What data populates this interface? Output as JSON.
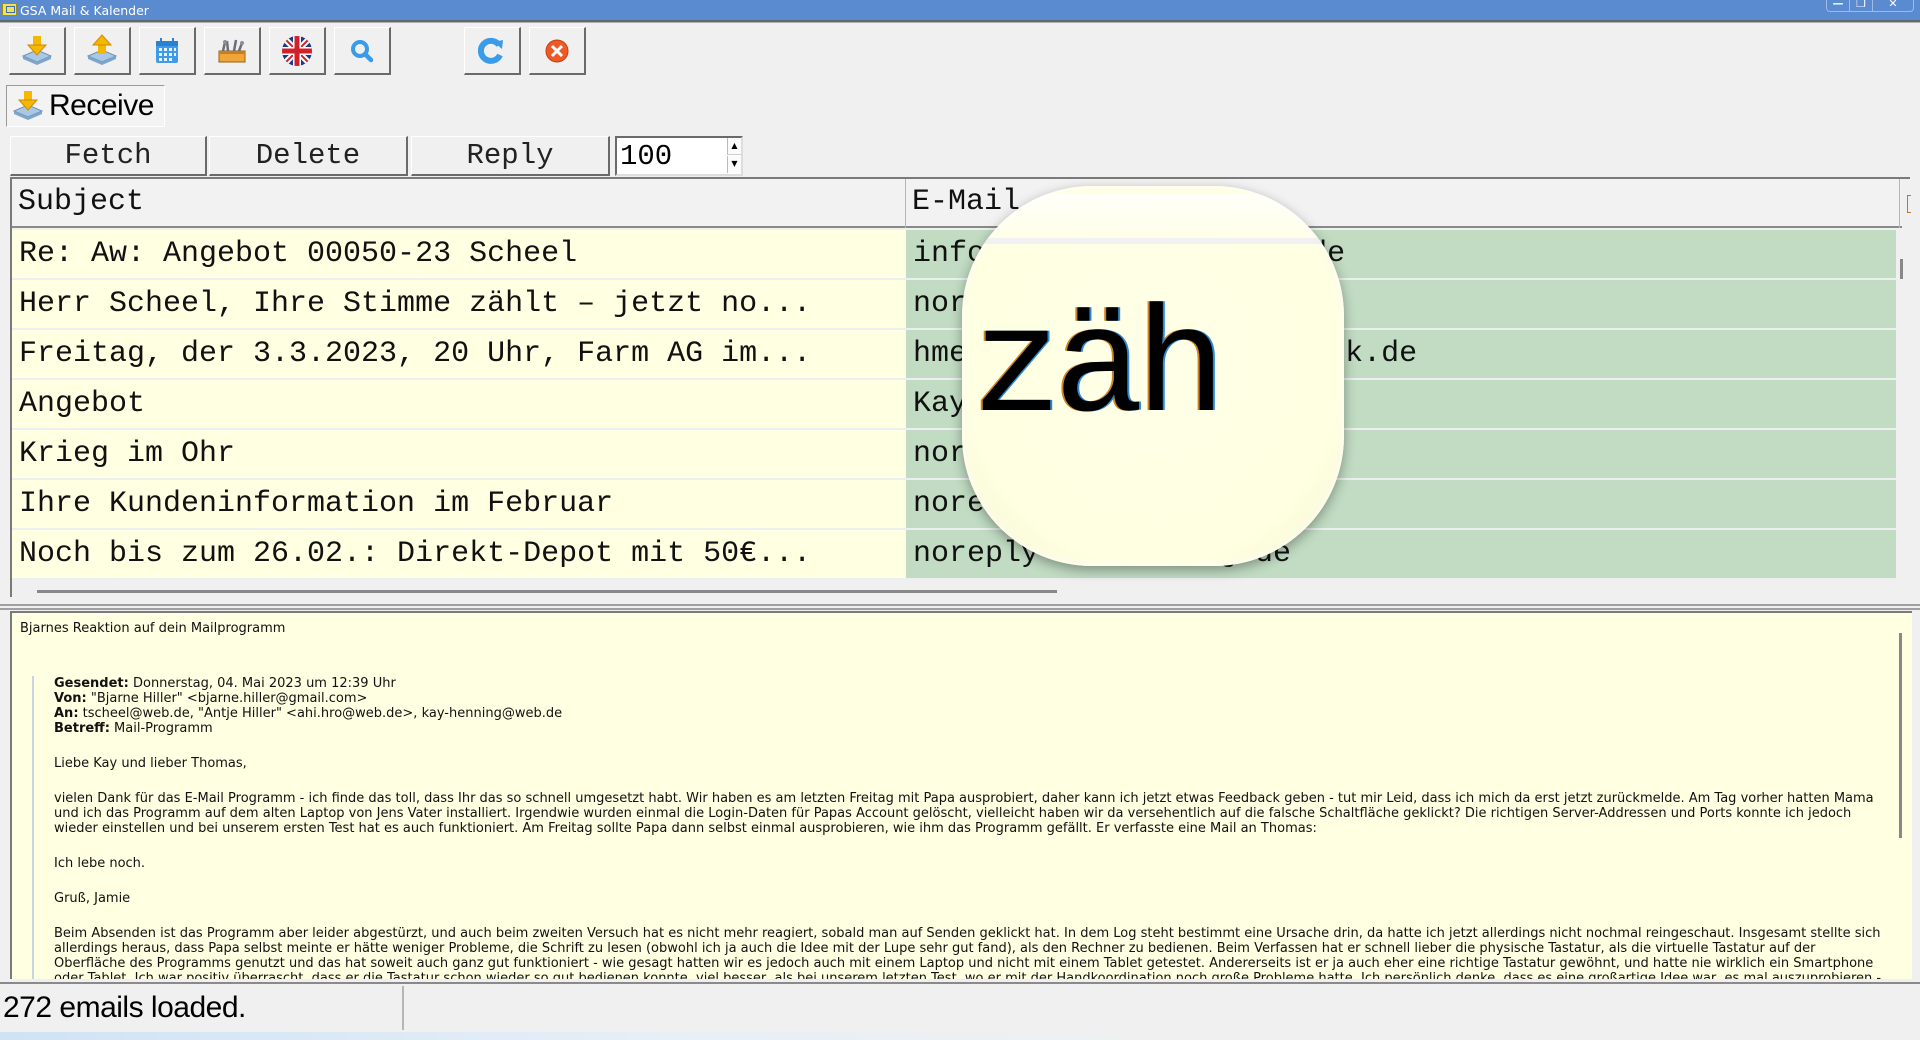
{
  "window": {
    "title": "GSA Mail & Kalender",
    "controls": {
      "minimize": "—",
      "restore": "❐",
      "close": "✕"
    }
  },
  "toolbar": {
    "buttons": [
      {
        "icon": "download-icon",
        "tooltip": "Receive"
      },
      {
        "icon": "upload-icon",
        "tooltip": "Send"
      },
      {
        "icon": "calendar-icon",
        "tooltip": "Calendar"
      },
      {
        "icon": "toolbox-icon",
        "tooltip": "Tools"
      },
      {
        "icon": "uk-flag-icon",
        "tooltip": "Language"
      },
      {
        "icon": "magnifier-icon",
        "tooltip": "Magnifier"
      },
      {
        "icon": "refresh-icon",
        "tooltip": "Refresh"
      },
      {
        "icon": "close-circle-icon",
        "tooltip": "Exit"
      }
    ]
  },
  "mode_label": "Receive",
  "actions": {
    "fetch": "Fetch",
    "delete": "Delete",
    "reply": "Reply",
    "count_value": "100"
  },
  "table": {
    "columns": [
      "Subject",
      "E-Mail"
    ],
    "rows": [
      {
        "subject": "Re: Aw: Angebot 00050-23 Scheel",
        "email": "info                n.de"
      },
      {
        "subject": "Herr Scheel, Ihre Stimme zählt – jetzt no...",
        "email": "nor"
      },
      {
        "subject": "Freitag, der 3.3.2023, 20 Uhr, Farm AG im...",
        "email": "hme                 stock.de"
      },
      {
        "subject": "Angebot",
        "email": "Kay                ck.de"
      },
      {
        "subject": "Krieg im Ohr",
        "email": "nor                f.de"
      },
      {
        "subject": "Ihre Kundeninformation im Februar",
        "email": "nore"
      },
      {
        "subject": "Noch bis zum 26.02.: Direkt-Depot mit 50€...",
        "email": "noreply          g.de"
      }
    ]
  },
  "magnifier": {
    "text": "zäh"
  },
  "preview": {
    "subject": "Bjarnes Reaktion auf dein Mailprogramm",
    "headers": [
      {
        "label": "Gesendet:",
        "value": " Donnerstag, 04. Mai 2023 um 12:39 Uhr"
      },
      {
        "label": "Von:",
        "value": " \"Bjarne Hiller\" <bjarne.hiller@gmail.com>"
      },
      {
        "label": "An:",
        "value": " tscheel@web.de, \"Antje Hiller\" <ahi.hro@web.de>, kay-henning@web.de"
      },
      {
        "label": "Betreff:",
        "value": " Mail-Programm"
      }
    ],
    "greeting": "Liebe Kay und lieber Thomas,",
    "paragraph1": "vielen Dank für das E-Mail Programm - ich finde das toll, dass Ihr das so schnell umgesetzt habt. Wir haben es am letzten Freitag mit Papa ausprobiert, daher kann ich jetzt etwas Feedback geben - tut mir Leid, dass ich mich da erst jetzt zurückmelde. Am Tag vorher hatten Mama und ich das Programm auf dem alten Laptop von Jens Vater installiert. Irgendwie wurden einmal die Login-Daten für Papas Account gelöscht, vielleicht haben wir da versehentlich auf die falsche Schaltfläche geklickt? Die richtigen Server-Addressen und Ports konnte ich jedoch wieder einstellen und bei unserem ersten Test hat es auch funktioniert. Am Freitag sollte Papa dann selbst einmal ausprobieren, wie ihm das Programm gefällt. Er verfasste eine Mail an Thomas:",
    "quote_line": "Ich lebe noch.",
    "signoff": "Gruß, Jamie",
    "paragraph2": "Beim Absenden ist das Programm aber leider abgestürzt, und auch beim zweiten Versuch hat es nicht mehr reagiert, sobald man auf Senden geklickt hat. In dem Log steht bestimmt eine Ursache drin, da hatte ich jetzt allerdings nicht nochmal reingeschaut. Insgesamt stellte sich allerdings heraus, dass Papa selbst meinte er hätte weniger Probleme, die Schrift zu lesen (obwohl ich ja auch die Idee mit der Lupe sehr gut fand), als den Rechner zu bedienen. Beim Verfassen hat er schnell lieber die physische Tastatur, als die virtuelle Tastatur auf der Oberfläche des Programms genutzt und das hat soweit auch ganz gut funktioniert - wie gesagt hatten wir es jedoch auch mit einem Laptop und nicht mit einem Tablet getestet. Andererseits ist er ja auch eher eine richtige Tastatur gewöhnt, und hatte nie wirklich ein Smartphone oder Tablet. Ich war positiv überrascht, dass er die Tastatur schon wieder so gut bedienen konnte, viel besser, als bei unserem letzten Test, wo er mit der Handkoordination noch große Probleme hatte. Ich persönlich denke, dass es eine großartige Idee war, es mal auszuprobieren - aber sich jetzt doch die Frage stellt, ob man das E-Mail Programm noch weiterentwickeln möchte, was ja auch Zeit und Arbeit kostet. Am sinnvollsten wäre glaube ich eher eine große, physische \"Seniorentastatur\" in Kombination mit einem E-Mail-Programm, mit dessen Bedienung er vertraut ist. Falls Du das Programm trotzdem noch weiterentwickeln möchtest, habe ich hier nochmal ein paar konkrete Anregungen:"
  },
  "status": {
    "message": "272 emails loaded."
  },
  "colors": {
    "titlebar": "#5a8bd1",
    "subject_bg": "#ffffe1",
    "email_bg": "#c1dcc3",
    "preview_bg": "#ffffe1"
  }
}
